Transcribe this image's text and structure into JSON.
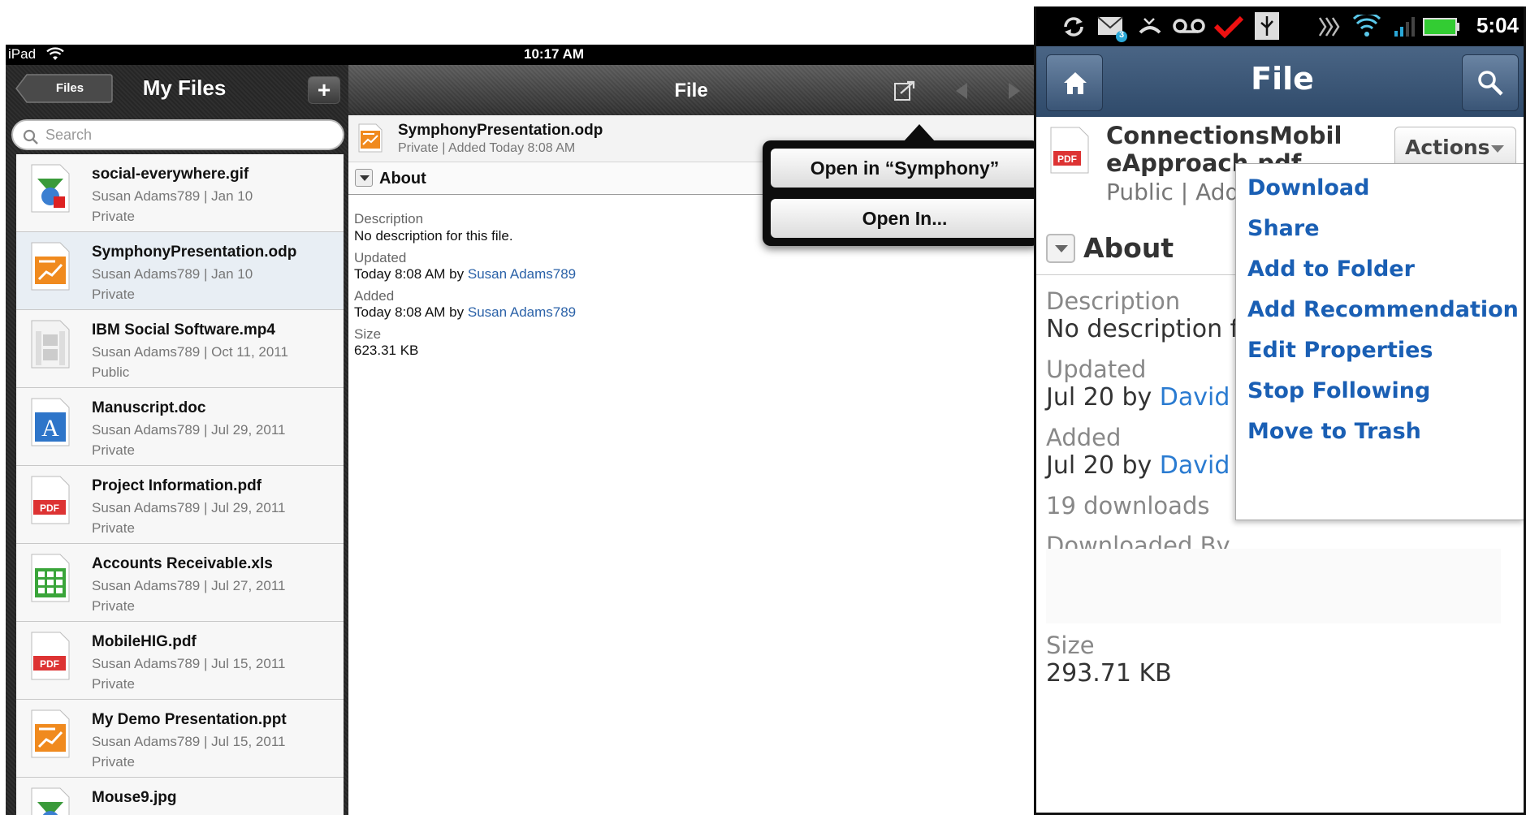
{
  "ipad": {
    "status": {
      "carrier": "iPad",
      "time": "10:17 AM"
    },
    "left": {
      "back_label": "Files",
      "title": "My Files",
      "add_label": "+",
      "search_placeholder": "Search",
      "files": [
        {
          "name": "social-everywhere.gif",
          "meta": "Susan Adams789 | Jan 10",
          "visibility": "Private",
          "icon": "image-file-icon"
        },
        {
          "name": "SymphonyPresentation.odp",
          "meta": "Susan Adams789 | Jan 10",
          "visibility": "Private",
          "icon": "presentation-file-icon"
        },
        {
          "name": "IBM Social Software.mp4",
          "meta": "Susan Adams789 | Oct 11, 2011",
          "visibility": "Public",
          "icon": "video-file-icon"
        },
        {
          "name": "Manuscript.doc",
          "meta": "Susan Adams789 | Jul 29, 2011",
          "visibility": "Private",
          "icon": "document-file-icon"
        },
        {
          "name": "Project Information.pdf",
          "meta": "Susan Adams789 | Jul 29, 2011",
          "visibility": "Private",
          "icon": "pdf-file-icon"
        },
        {
          "name": "Accounts Receivable.xls",
          "meta": "Susan Adams789 | Jul 27, 2011",
          "visibility": "Private",
          "icon": "spreadsheet-file-icon"
        },
        {
          "name": "MobileHIG.pdf",
          "meta": "Susan Adams789 | Jul 15, 2011",
          "visibility": "Private",
          "icon": "pdf-file-icon"
        },
        {
          "name": "My Demo Presentation.ppt",
          "meta": "Susan Adams789 | Jul 15, 2011",
          "visibility": "Private",
          "icon": "presentation-file-icon"
        },
        {
          "name": "Mouse9.jpg",
          "meta": "",
          "visibility": "",
          "icon": "image-file-icon"
        }
      ]
    },
    "right": {
      "title": "File",
      "file_name": "SymphonyPresentation.odp",
      "file_meta": "Private | Added Today 8:08 AM",
      "about_label": "About",
      "description_label": "Description",
      "description_value": "No description for this file.",
      "updated_label": "Updated",
      "updated_prefix": "Today 8:08 AM by ",
      "updated_user": "Susan Adams789",
      "added_label": "Added",
      "added_prefix": "Today 8:08 AM by ",
      "added_user": "Susan Adams789",
      "size_label": "Size",
      "size_value": "623.31 KB"
    },
    "popover": {
      "open_in_app": "Open in “Symphony”",
      "open_in": "Open In..."
    }
  },
  "android": {
    "status": {
      "time": "5:04",
      "mail_badge": "3"
    },
    "title": "File",
    "file_name": "ConnectionsMobileApproach.pdf",
    "file_name_line1": "ConnectionsMobil",
    "file_name_line2": "eApproach.pdf",
    "file_meta": "Public | Add",
    "actions_label": "Actions",
    "about_label": "About",
    "description_label": "Description",
    "description_value": "No description f",
    "updated_label": "Updated",
    "updated_prefix": "Jul 20 by ",
    "updated_user": "David",
    "added_label": "Added",
    "added_prefix": "Jul 20 by ",
    "added_user": "David",
    "downloads": "19 downloads",
    "downloaded_by_label": "Downloaded By",
    "size_label": "Size",
    "size_value": "293.71 KB",
    "menu": [
      "Download",
      "Share",
      "Add to Folder",
      "Add Recommendation",
      "Edit Properties",
      "Stop Following",
      "Move to Trash"
    ]
  },
  "colors": {
    "link_blue": "#2b62a8",
    "android_menu_blue": "#1a5fb4",
    "android_bar": "#3d5878"
  }
}
